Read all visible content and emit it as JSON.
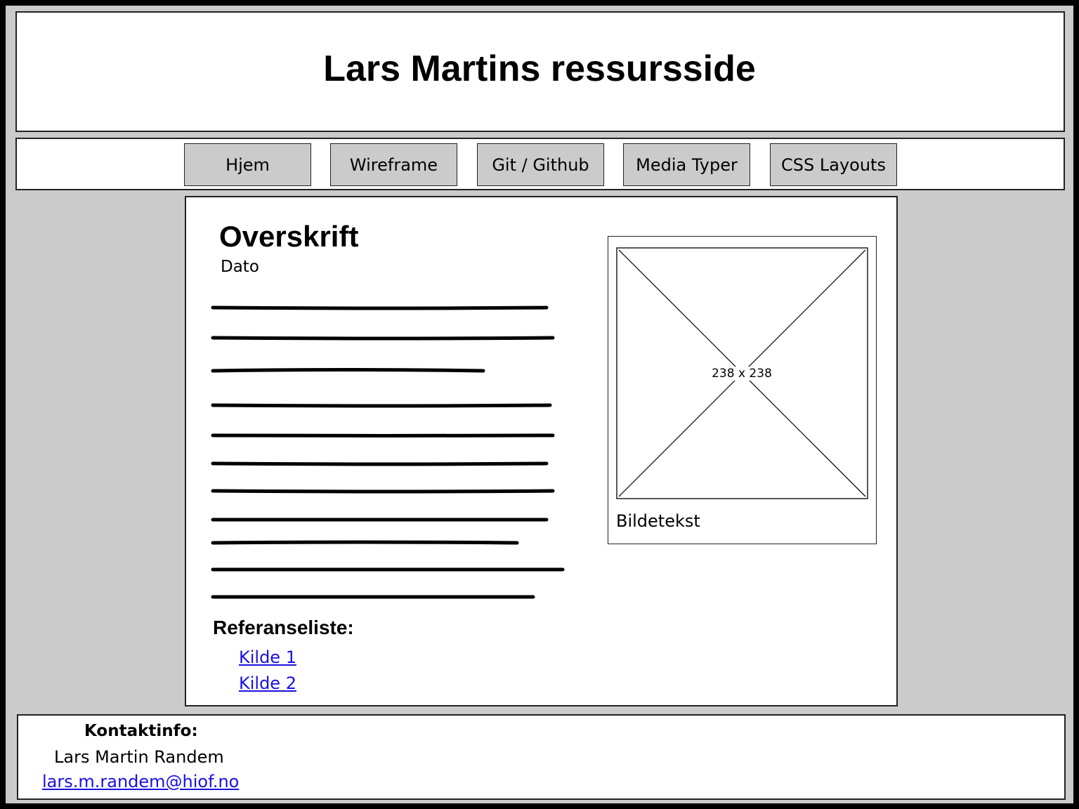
{
  "header": {
    "title": "Lars Martins ressursside"
  },
  "nav": {
    "items": [
      {
        "label": "Hjem"
      },
      {
        "label": "Wireframe"
      },
      {
        "label": "Git / Github"
      },
      {
        "label": "Media Typer"
      },
      {
        "label": "CSS Layouts"
      }
    ]
  },
  "article": {
    "heading": "Overskrift",
    "date": "Dato",
    "text_line_count": 11,
    "references": {
      "heading": "Referanseliste:",
      "links": [
        {
          "label": "Kilde 1"
        },
        {
          "label": "Kilde 2"
        }
      ]
    }
  },
  "figure": {
    "image_size_label": "238 x 238",
    "caption": "Bildetekst"
  },
  "footer": {
    "contact_heading": "Kontaktinfo:",
    "name": "Lars Martin Randem",
    "email": "lars.m.randem@hiof.no"
  },
  "colors": {
    "background": "#cbcbcb",
    "panel": "#ffffff",
    "border": "#222222",
    "nav_button": "#cbcbcb",
    "link": "#1a10e0",
    "outer_frame": "#000000"
  }
}
